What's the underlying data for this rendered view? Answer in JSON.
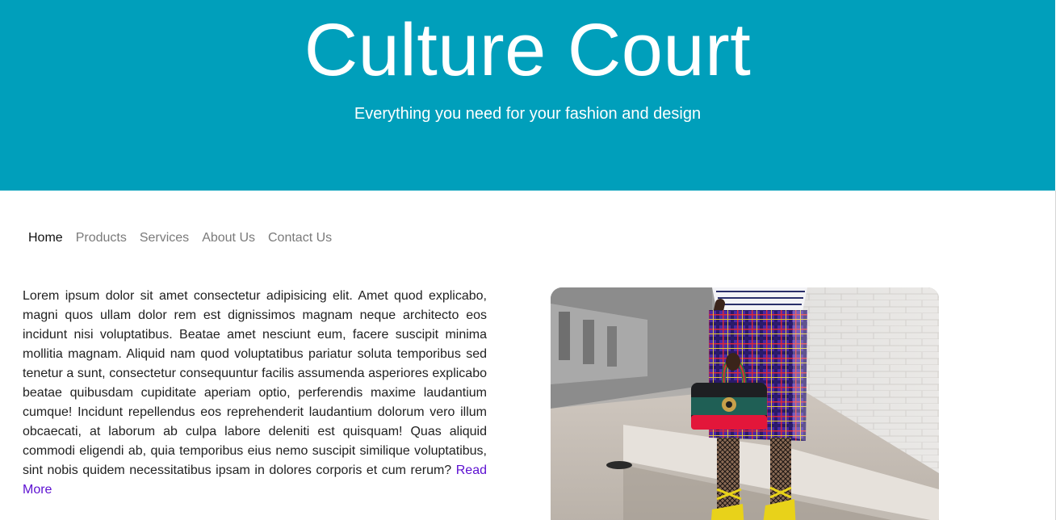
{
  "header": {
    "title": "Culture Court",
    "subtitle": "Everything you need for your fashion and design"
  },
  "nav": {
    "items": [
      {
        "label": "Home",
        "active": true
      },
      {
        "label": "Products",
        "active": false
      },
      {
        "label": "Services",
        "active": false
      },
      {
        "label": "About Us",
        "active": false
      },
      {
        "label": "Contact Us",
        "active": false
      }
    ]
  },
  "main": {
    "paragraph": "Lorem ipsum dolor sit amet consectetur adipisicing elit. Amet quod explicabo, magni quos ullam dolor rem est dignissimos magnam neque architecto eos incidunt nisi voluptatibus. Beatae amet nesciunt eum, facere suscipit minima mollitia magnam. Aliquid nam quod voluptatibus pariatur soluta temporibus sed tenetur a sunt, consectetur consequuntur facilis assumenda asperiores explicabo beatae quibusdam cupiditate aperiam optio, perferendis maxime laudantium cumque! Incidunt repellendus eos reprehenderit laudantium dolorum vero illum obcaecati, at laborum ab culpa labore deleniti est quisquam! Quas aliquid commodi eligendi ab, quia temporibus eius nemo suscipit similique voluptatibus, sint nobis quidem necessitatibus ipsam in dolores corporis et cum rerum?",
    "read_more": "Read More"
  },
  "image": {
    "subject": "fashion-photo"
  },
  "colors": {
    "header_bg": "#009fbb",
    "link": "#5c0fd1",
    "nav_active": "#111111",
    "nav_inactive": "#7a7a7a"
  }
}
